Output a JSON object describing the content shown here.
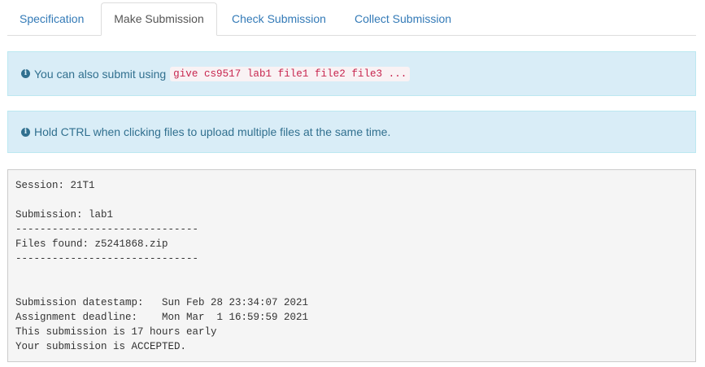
{
  "tabs": [
    {
      "label": "Specification",
      "active": false
    },
    {
      "label": "Make Submission",
      "active": true
    },
    {
      "label": "Check Submission",
      "active": false
    },
    {
      "label": "Collect Submission",
      "active": false
    }
  ],
  "alerts": {
    "give_text": "You can also submit using",
    "give_command": "give cs9517 lab1 file1 file2 file3 ...",
    "ctrl_text": "Hold CTRL when clicking files to upload multiple files at the same time."
  },
  "output": {
    "lines": [
      "Session: 21T1",
      "",
      "Submission: lab1",
      "------------------------------",
      "Files found: z5241868.zip",
      "------------------------------",
      "",
      "",
      "Submission datestamp:   Sun Feb 28 23:34:07 2021",
      "Assignment deadline:    Mon Mar  1 16:59:59 2021",
      "This submission is 17 hours early",
      "Your submission is ACCEPTED."
    ]
  },
  "colors": {
    "link": "#337ab7",
    "alert_bg": "#d9edf7",
    "alert_text": "#31708f",
    "code_text": "#c7254e"
  },
  "icons": {
    "info": "info-circle-icon"
  }
}
